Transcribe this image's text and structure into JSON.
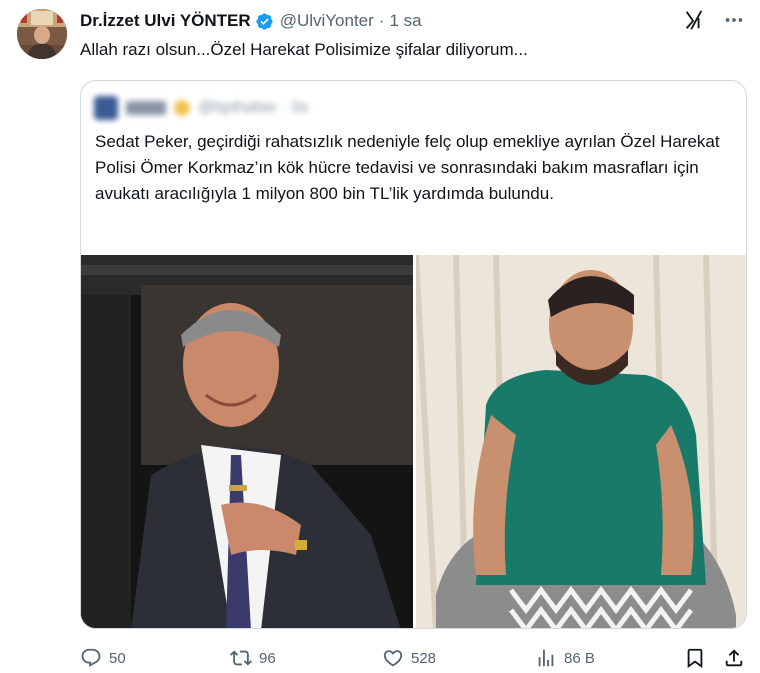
{
  "tweet": {
    "author_name": "Dr.İzzet Ulvi YÖNTER",
    "handle": "@UlviYonter",
    "separator": "·",
    "time": "1 sa",
    "text": "Allah razı olsun...Özel Harekat Polisimize şifalar diliyorum...",
    "icons": [
      "grok-icon",
      "more-icon",
      "verified-badge-icon"
    ]
  },
  "quote": {
    "handle_blurred": "@bpthaber · 0s",
    "text": "Sedat Peker, geçirdiği rahatsızlık nedeniyle felç olup emekliye ayrılan Özel Harekat Polisi Ömer Korkmaz’ın kök hücre tedavisi ve sonrasındaki bakım masrafları için avukatı aracılığıyla 1 milyon 800 bin TL’lik yardımda bulundu."
  },
  "actions": {
    "replies": "50",
    "retweets": "96",
    "likes": "528",
    "views": "86 B",
    "icons": [
      "reply-icon",
      "retweet-icon",
      "like-icon",
      "views-icon",
      "bookmark-icon",
      "share-icon"
    ]
  },
  "colors": {
    "text": "#0f1419",
    "muted": "#536471",
    "border": "#cfd9de",
    "verified": "#1d9bf0"
  }
}
